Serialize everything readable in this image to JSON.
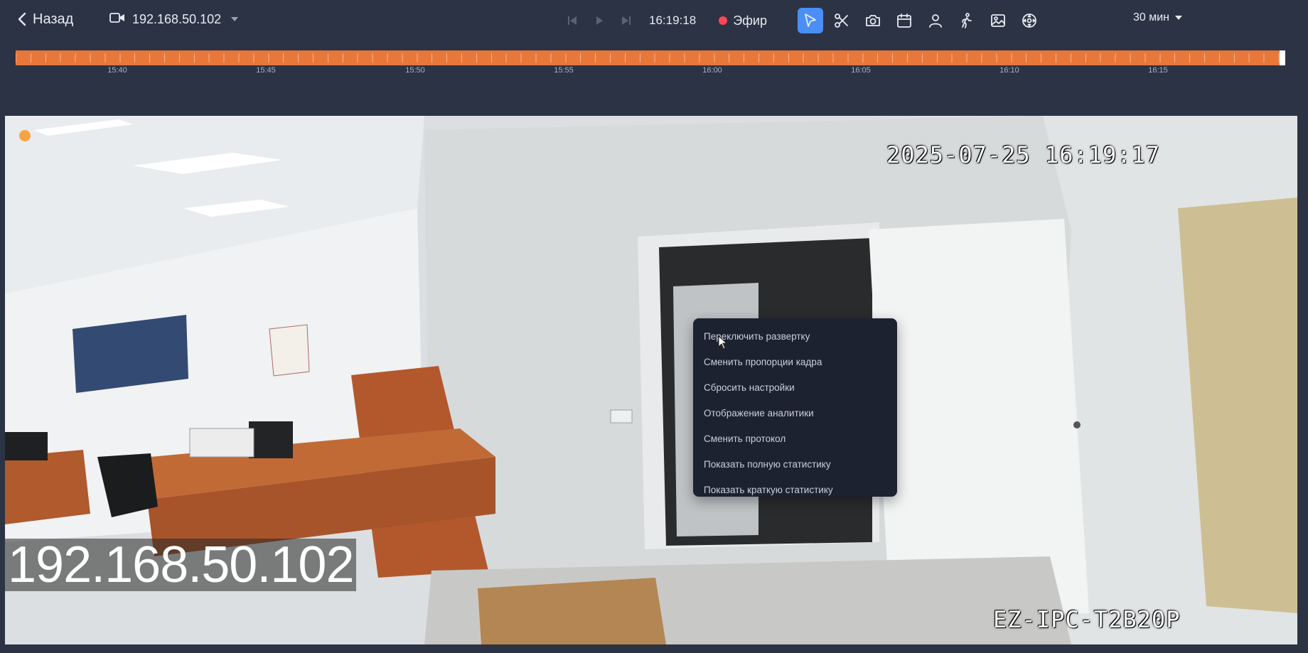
{
  "header": {
    "back_label": "Назад",
    "camera_name": "192.168.50.102",
    "current_time": "16:19:18",
    "live_label": "Эфир",
    "range_label": "30 мин"
  },
  "tools": [
    {
      "icon": "pointer-icon",
      "active": true
    },
    {
      "icon": "scissors-icon",
      "active": false
    },
    {
      "icon": "camera-icon",
      "active": false
    },
    {
      "icon": "calendar-icon",
      "active": false
    },
    {
      "icon": "person-icon",
      "active": false
    },
    {
      "icon": "walking-person-icon",
      "active": false
    },
    {
      "icon": "image-icon",
      "active": false
    },
    {
      "icon": "ptz-control-icon",
      "active": false
    }
  ],
  "timeline": {
    "labels": [
      "15:40",
      "15:45",
      "15:50",
      "15:55",
      "16:00",
      "16:05",
      "16:10",
      "16:15"
    ],
    "color": "#e8773a",
    "playhead": "live (end)"
  },
  "video": {
    "osd_timestamp": "2025-07-25 16:19:17",
    "osd_model": "EZ-IPC-T2B20P",
    "ip_overlay": "192.168.50.102"
  },
  "context_menu": {
    "items": [
      "Переключить развертку",
      "Сменить пропорции кадра",
      "Сбросить настройки",
      "Отображение аналитики",
      "Сменить протокол",
      "Показать полную статистику",
      "Показать краткую статистику"
    ]
  },
  "colors": {
    "background": "#2c3344",
    "accent": "#4a8ff5",
    "live_dot": "#ff4757",
    "menu_bg": "#1d2230"
  }
}
